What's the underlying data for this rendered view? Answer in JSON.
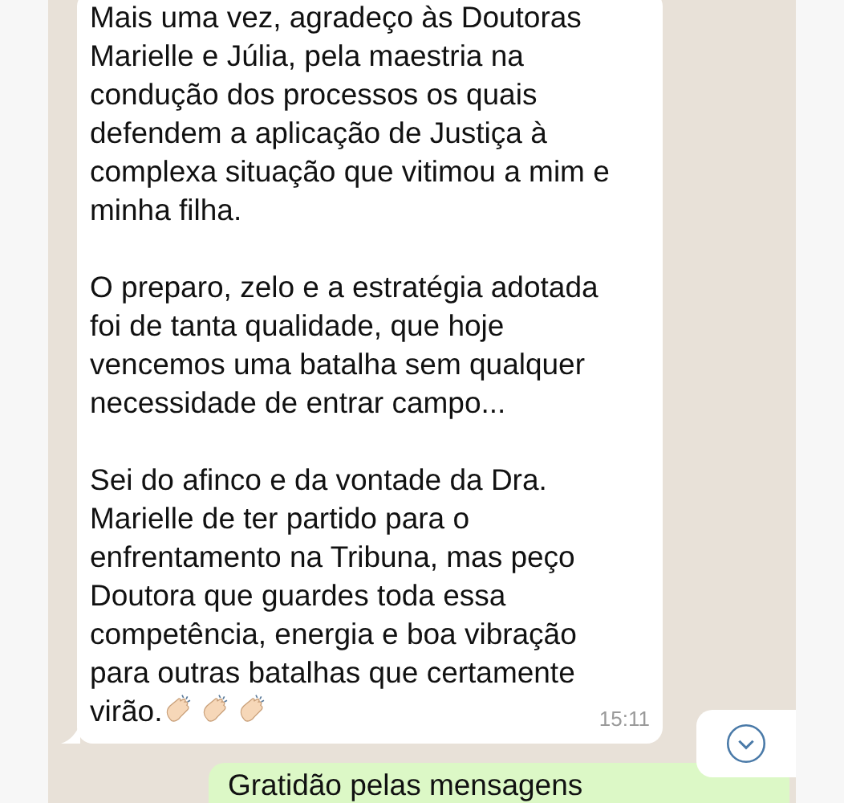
{
  "incoming_message": {
    "paragraphs": [
      "Mais uma vez, agradeço às Doutoras\nMarielle e Júlia, pela maestria na\ncondução dos processos os quais\ndefendem a aplicação de Justiça à\ncomplexa situação que vitimou a mim e\nminha filha.",
      "O preparo, zelo e a estratégia adotada\nfoi de tanta qualidade, que hoje\nvencemos uma batalha sem qualquer\nnecessidade de entrar campo...",
      "Sei do afinco e da vontade da Dra.\nMarielle de ter partido para o\nenfrentamento na Tribuna, mas peço\nDoutora que guardes toda essa\ncompetência, energia e boa vibração\npara outras batalhas que certamente\nvirão."
    ],
    "time": "15:11"
  },
  "outgoing_message": {
    "text": "Gratidão pelas mensagens"
  }
}
